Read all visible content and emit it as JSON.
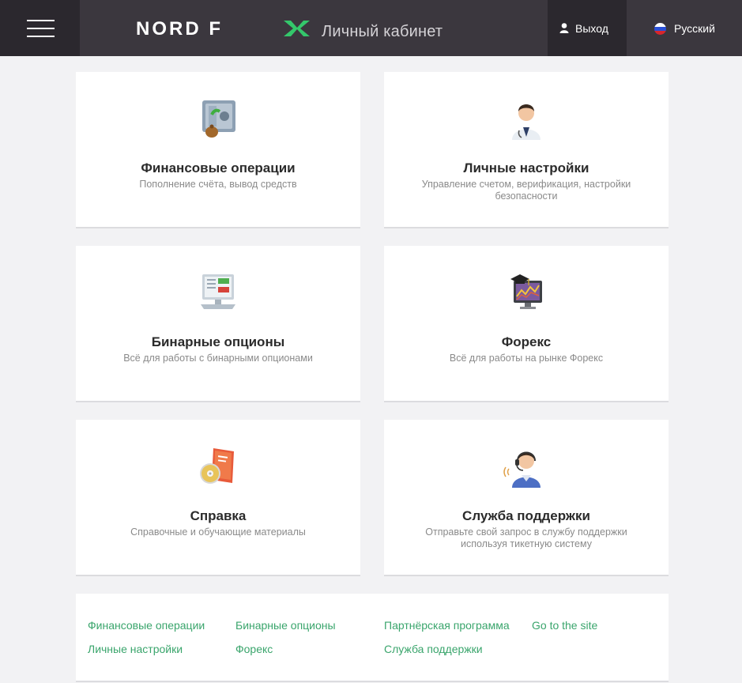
{
  "header": {
    "logo_text": "NORD FX",
    "title": "Личный кабинет",
    "exit_label": "Выход",
    "language_label": "Русский",
    "bar_color": "#3b373e",
    "accent_color": "#34c76b"
  },
  "cards": [
    {
      "title": "Финансовые операции",
      "subtitle": "Пополнение счёта, вывод средств",
      "icon": "safe-money-icon"
    },
    {
      "title": "Личные настройки",
      "subtitle": "Управление счетом, верификация, настройки безопасности",
      "icon": "doctor-person-icon"
    },
    {
      "title": "Бинарные опционы",
      "subtitle": "Всё для работы с бинарными опционами",
      "icon": "computer-chart-icon"
    },
    {
      "title": "Форекс",
      "subtitle": "Всё для работы на рынке Форекс",
      "icon": "monitor-graduation-cap-icon"
    },
    {
      "title": "Справка",
      "subtitle": "Справочные и обучающие материалы",
      "icon": "book-disc-icon"
    },
    {
      "title": "Служба поддержки",
      "subtitle": "Отправьте свой запрос в службу поддержки используя тикетную систему",
      "icon": "headset-operator-icon"
    }
  ],
  "footer": {
    "links": [
      "Финансовые операции",
      "Бинарные опционы",
      "Партнёрская программа",
      "Go to the site",
      "Личные настройки",
      "Форекс",
      "Служба поддержки"
    ],
    "link_color": "#3aa56c"
  }
}
